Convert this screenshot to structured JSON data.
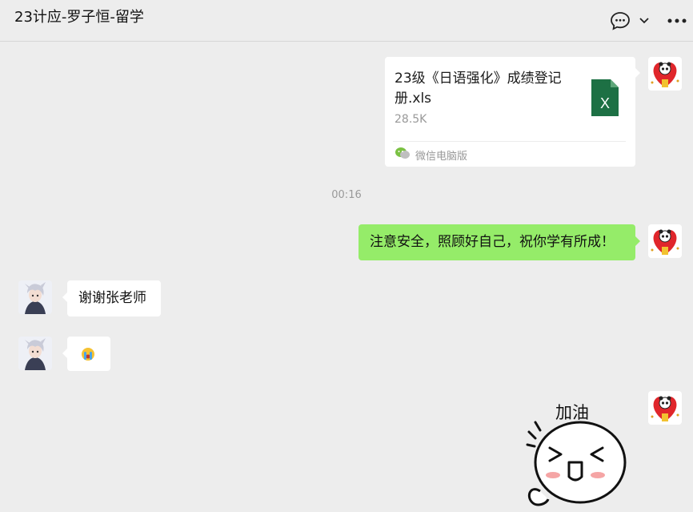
{
  "header": {
    "title": "23计应-罗子恒-留学",
    "icons": [
      "chat-bubble-icon",
      "chevron-down-icon",
      "more-icon"
    ]
  },
  "messages": {
    "file": {
      "name": "23级《日语强化》成绩登记册.xls",
      "size": "28.5K",
      "source": "微信电脑版",
      "icon": "excel-file-icon",
      "icon_letter": "X",
      "icon_color": "#1d7044"
    },
    "timestamp": "00:16",
    "outgoing_text": "注意安全，照顾好自己，祝你学有所成！",
    "incoming_text": "谢谢张老师",
    "incoming_emoji": "crying-face-emoji",
    "sticker_text": "加油"
  },
  "colors": {
    "background": "#ededed",
    "sent_bubble": "#95ec69",
    "received_bubble": "#ffffff",
    "secondary_text": "#999999"
  }
}
